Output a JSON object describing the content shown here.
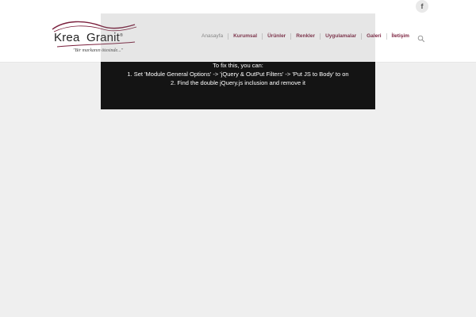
{
  "social": {
    "facebook_glyph": "f"
  },
  "logo": {
    "word1": "Krea",
    "word2": "Granit",
    "registered": "®",
    "tagline": "\"Bir markanın ötesinde...\"",
    "accent_color": "#7a1f3c"
  },
  "nav": {
    "items": [
      {
        "label": "Anasayfa",
        "active": true
      },
      {
        "label": "Kurumsal"
      },
      {
        "label": "Ürünler"
      },
      {
        "label": "Renkler"
      },
      {
        "label": "Uygulamalar"
      },
      {
        "label": "Galeri"
      },
      {
        "label": "İletişim"
      }
    ],
    "color": "#7a1f3c",
    "search_icon": "search-icon"
  },
  "error": {
    "intro": "To fix this, you can:",
    "step1": "1. Set 'Module General Options' -> 'jQuery & OutPut Filters' -> 'Put JS to Body' to on",
    "step2": "2. Find the double jQuery.js inclusion and remove it"
  }
}
